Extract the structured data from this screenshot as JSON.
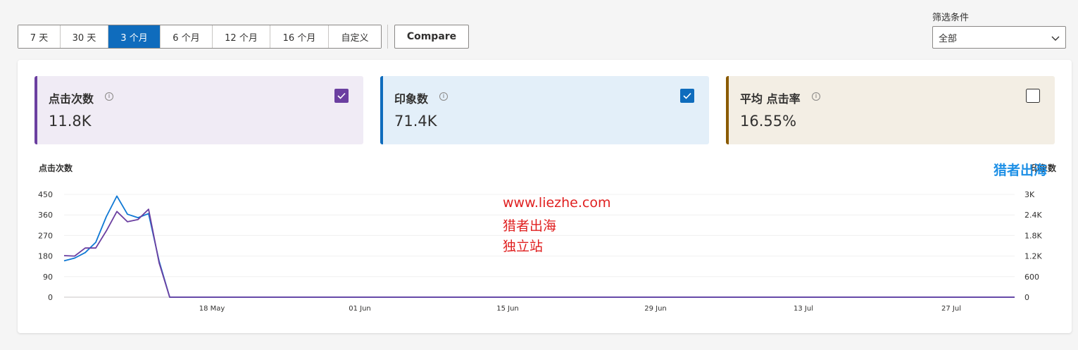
{
  "range_buttons": [
    {
      "label": "7 天",
      "active": false
    },
    {
      "label": "30 天",
      "active": false
    },
    {
      "label": "3 个月",
      "active": true
    },
    {
      "label": "6 个月",
      "active": false
    },
    {
      "label": "12 个月",
      "active": false
    },
    {
      "label": "16 个月",
      "active": false
    },
    {
      "label": "自定义",
      "active": false
    }
  ],
  "compare_label": "Compare",
  "filter": {
    "label": "筛选条件",
    "selected": "全部"
  },
  "cards": [
    {
      "title": "点击次数",
      "value": "11.8K",
      "checked": true,
      "bg": "#f0ebf5",
      "accent": "#6b3fa0"
    },
    {
      "title": "印象数",
      "value": "71.4K",
      "checked": true,
      "bg": "#e3eff9",
      "accent": "#0f6cbd"
    },
    {
      "title": "平均 点击率",
      "value": "16.55%",
      "checked": false,
      "bg": "#f3eee4",
      "accent": "#8a5a00"
    }
  ],
  "watermarks": {
    "top_right": "猎者出海",
    "center": [
      "www.liezhe.com",
      "猎者出海",
      "独立站"
    ]
  },
  "chart_data": {
    "type": "line",
    "ylabel_left": "点击次数",
    "ylabel_right": "印象数",
    "left_ticks": [
      "0",
      "90",
      "180",
      "270",
      "360",
      "450"
    ],
    "right_ticks": [
      "0",
      "600",
      "1.2K",
      "1.8K",
      "2.4K",
      "3K"
    ],
    "ylim_left": [
      0,
      450
    ],
    "ylim_right": [
      0,
      3000
    ],
    "x_ticks": [
      {
        "label": "18 May",
        "index": 14
      },
      {
        "label": "01 Jun",
        "index": 28
      },
      {
        "label": "15 Jun",
        "index": 42
      },
      {
        "label": "29 Jun",
        "index": 56
      },
      {
        "label": "13 Jul",
        "index": 70
      },
      {
        "label": "27 Jul",
        "index": 84
      }
    ],
    "series": [
      {
        "name": "点击次数",
        "axis": "left",
        "color": "#6b3fa0",
        "values": [
          182,
          180,
          215,
          215,
          290,
          375,
          330,
          340,
          385,
          150,
          0,
          0,
          0,
          0,
          0,
          0,
          0,
          0,
          0,
          0,
          0,
          0,
          0,
          0,
          0,
          0,
          0,
          0,
          0,
          0,
          0,
          0,
          0,
          0,
          0,
          0,
          0,
          0,
          0,
          0,
          0,
          0,
          0,
          0,
          0,
          0,
          0,
          0,
          0,
          0,
          0,
          0,
          0,
          0,
          0,
          0,
          0,
          0,
          0,
          0,
          0,
          0,
          0,
          0,
          0,
          0,
          0,
          0,
          0,
          0,
          0,
          0,
          0,
          0,
          0,
          0,
          0,
          0,
          0,
          0,
          0,
          0,
          0,
          0,
          0,
          0,
          0,
          0,
          0,
          0,
          0
        ]
      },
      {
        "name": "印象数",
        "axis": "right",
        "color": "#0f78d4",
        "values": [
          1060,
          1140,
          1300,
          1600,
          2350,
          2950,
          2420,
          2320,
          2440,
          1050,
          0,
          0,
          0,
          0,
          0,
          0,
          0,
          0,
          0,
          0,
          0,
          0,
          0,
          0,
          0,
          0,
          0,
          0,
          0,
          0,
          0,
          0,
          0,
          0,
          0,
          0,
          0,
          0,
          0,
          0,
          0,
          0,
          0,
          0,
          0,
          0,
          0,
          0,
          0,
          0,
          0,
          0,
          0,
          0,
          0,
          0,
          0,
          0,
          0,
          0,
          0,
          0,
          0,
          0,
          0,
          0,
          0,
          0,
          0,
          0,
          0,
          0,
          0,
          0,
          0,
          0,
          0,
          0,
          0,
          0,
          0,
          0,
          0,
          0,
          0,
          0,
          0,
          0,
          0,
          0,
          0
        ]
      }
    ]
  }
}
